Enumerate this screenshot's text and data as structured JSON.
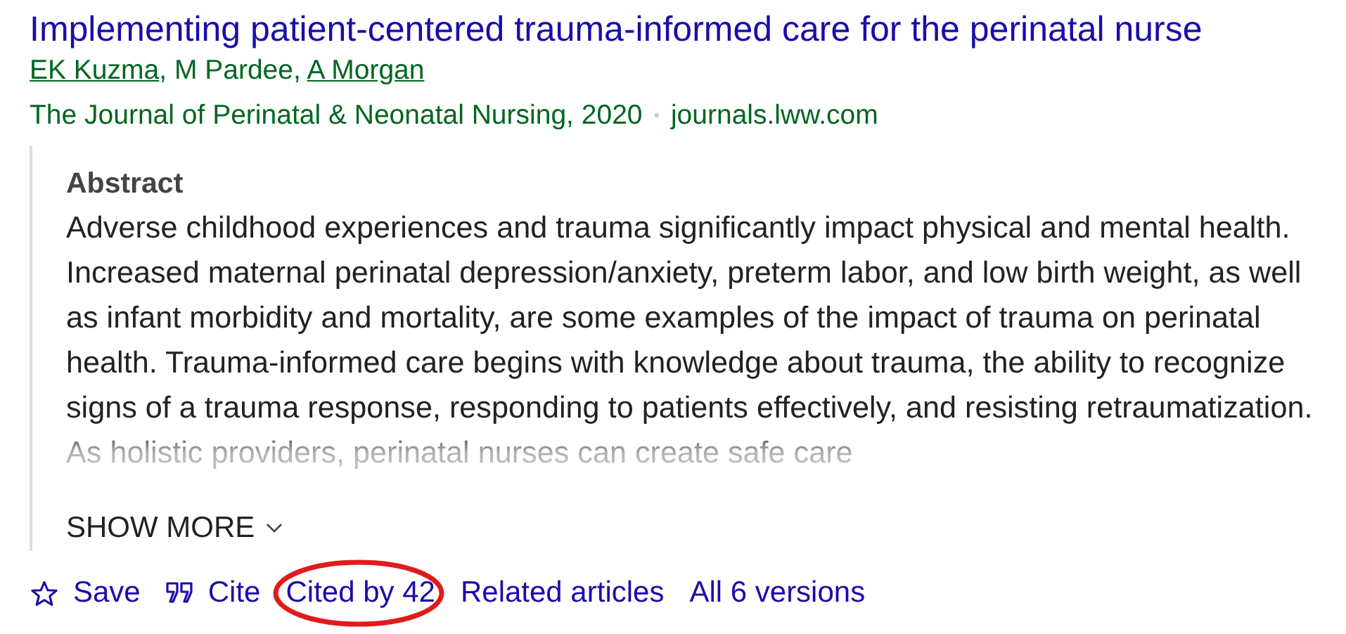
{
  "title": "Implementing patient-centered trauma-informed care for the perinatal nurse",
  "authors": [
    {
      "text": "EK Kuzma",
      "linked": true
    },
    {
      "text": ", M Pardee, ",
      "linked": false
    },
    {
      "text": "A Morgan",
      "linked": true
    }
  ],
  "source": {
    "journal": "The Journal of Perinatal & Neonatal Nursing, 2020",
    "separator": "•",
    "domain": "journals.lww.com"
  },
  "abstract": {
    "heading": "Abstract",
    "text": "Adverse childhood experiences and trauma significantly impact physical and mental health. Increased maternal perinatal depression/anxiety, preterm labor, and low birth weight, as well as infant morbidity and mortality, are some examples of the impact of trauma on perinatal health. Trauma-informed care begins with knowledge about trauma, the ability to recognize signs of a trauma response, responding to patients effectively, and resisting retraumatization. As holistic providers, perinatal nurses can create safe care",
    "show_more": "SHOW MORE"
  },
  "actions": [
    {
      "kind": "save",
      "label": "Save",
      "highlighted": false
    },
    {
      "kind": "cite",
      "label": "Cite",
      "highlighted": false
    },
    {
      "kind": "link",
      "label": "Cited by 42",
      "highlighted": true
    },
    {
      "kind": "link",
      "label": "Related articles",
      "highlighted": false
    },
    {
      "kind": "link",
      "label": "All 6 versions",
      "highlighted": false
    }
  ]
}
